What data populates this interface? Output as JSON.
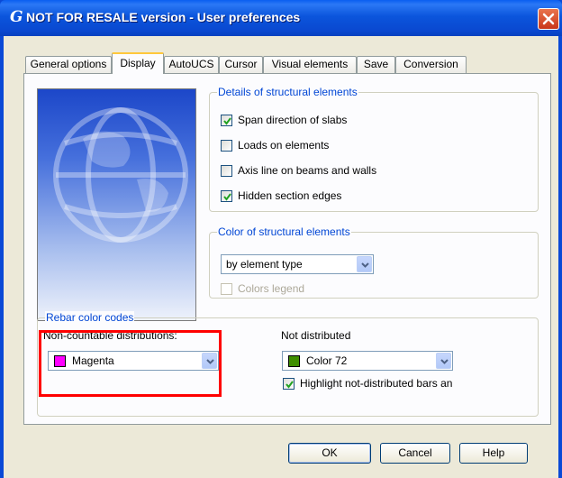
{
  "window": {
    "title": "NOT FOR RESALE version - User preferences",
    "icon": "g-app-icon",
    "title_color": "#0a49d6"
  },
  "tabs": [
    {
      "label": "General options",
      "active": false
    },
    {
      "label": "Display",
      "active": true
    },
    {
      "label": "AutoUCS",
      "active": false
    },
    {
      "label": "Cursor",
      "active": false
    },
    {
      "label": "Visual elements",
      "active": false
    },
    {
      "label": "Save",
      "active": false
    },
    {
      "label": "Conversion",
      "active": false
    }
  ],
  "details_group": {
    "label": "Details of structural elements",
    "items": [
      {
        "label": "Span direction of slabs",
        "checked": true
      },
      {
        "label": "Loads on elements",
        "checked": false
      },
      {
        "label": "Axis line on beams and walls",
        "checked": false
      },
      {
        "label": "Hidden section edges",
        "checked": true
      }
    ]
  },
  "color_group": {
    "label": "Color of structural elements",
    "select_value": "by element type",
    "legend_label": "Colors legend",
    "legend_checked": false,
    "legend_enabled": false
  },
  "rebar_group": {
    "label": "Rebar color codes",
    "non_countable_label": "Non-countable distributions:",
    "non_countable_value": "Magenta",
    "non_countable_color": "#ff00ff",
    "not_distributed_label": "Not distributed",
    "not_distributed_value": "Color 72",
    "not_distributed_color": "#3f8f00",
    "highlight_label": "Highlight not-distributed bars an",
    "highlight_checked": true
  },
  "buttons": {
    "ok": "OK",
    "cancel": "Cancel",
    "help": "Help"
  },
  "colors": {
    "group_label": "#0046d5",
    "annotation": "#ff0000"
  }
}
